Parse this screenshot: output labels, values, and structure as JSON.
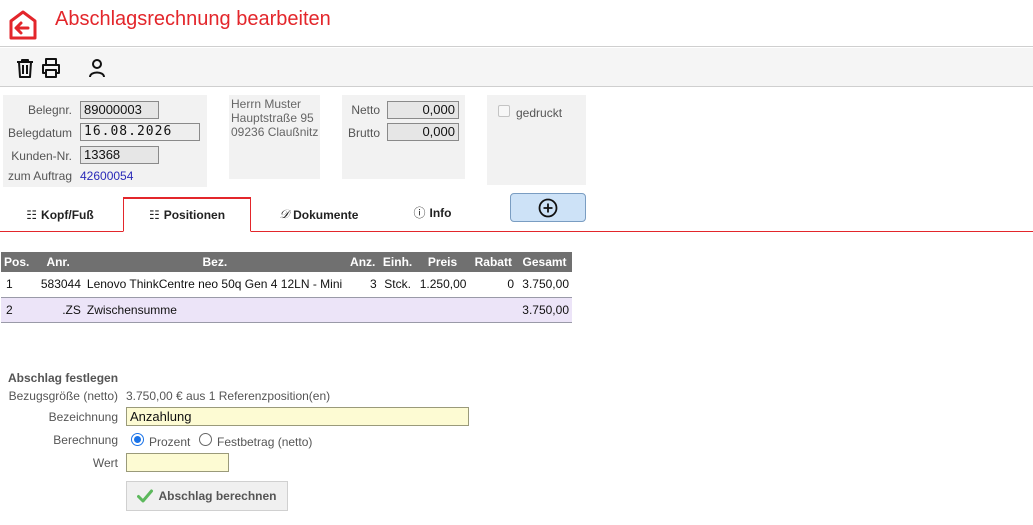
{
  "header": {
    "title": "Abschlagsrechnung bearbeiten"
  },
  "toolbar": {
    "icons": [
      "trash-icon",
      "print-icon",
      "person-icon"
    ]
  },
  "beleg": {
    "belegnr_label": "Belegnr.",
    "belegnr_value": "89000003",
    "datum_label": "Belegdatum",
    "datum_value": "16.08.2026",
    "kunden_label": "Kunden-Nr.",
    "kunden_value": "13368",
    "auftrag_label": "zum Auftrag",
    "auftrag_value": "42600054"
  },
  "address": {
    "line1": "Herrn Muster",
    "line2": "Hauptstraße 95",
    "line3": "09236 Claußnitz"
  },
  "totals": {
    "netto_label": "Netto",
    "netto_value": "0,000",
    "brutto_label": "Brutto",
    "brutto_value": "0,000"
  },
  "status": {
    "gedruckt_label": "gedruckt",
    "gedruckt_checked": false
  },
  "tabs": [
    {
      "label": "Kopf/Fuß",
      "icon": "list-icon",
      "active": false
    },
    {
      "label": "Positionen",
      "icon": "list-icon",
      "active": true
    },
    {
      "label": "Dokumente",
      "icon": "document-icon",
      "active": false
    },
    {
      "label": "Info",
      "icon": "info-icon",
      "active": false
    }
  ],
  "table": {
    "headers": [
      "Pos.",
      "Anr.",
      "Bez.",
      "Anz.",
      "Einh.",
      "Preis",
      "Rabatt",
      "Gesamt"
    ],
    "rows": [
      {
        "pos": "1",
        "anr": "583044",
        "bez": "Lenovo ThinkCentre neo 50q Gen 4 12LN - Mini",
        "anz": "3",
        "einh": "Stck.",
        "preis": "1.250,00",
        "rabatt": "0",
        "gesamt": "3.750,00"
      },
      {
        "pos": "2",
        "anr": ".ZS",
        "bez": "Zwischensumme",
        "anz": "",
        "einh": "",
        "preis": "",
        "rabatt": "",
        "gesamt": "3.750,00"
      }
    ]
  },
  "abschlag": {
    "title": "Abschlag festlegen",
    "bezugs_label": "Bezugsgröße (netto)",
    "bezugs_value": "3.750,00 € aus 1 Referenzposition(en)",
    "bezeichnung_label": "Bezeichnung",
    "bezeichnung_value": "Anzahlung",
    "berechnung_label": "Berechnung",
    "option_prozent": "Prozent",
    "option_festbetrag": "Festbetrag (netto)",
    "selected": "Prozent",
    "wert_label": "Wert",
    "wert_value": "",
    "button_label": "Abschlag berechnen"
  }
}
